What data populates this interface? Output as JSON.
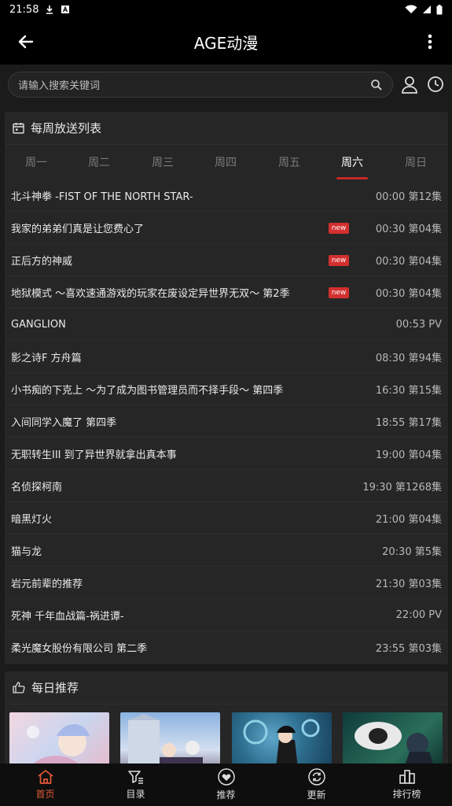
{
  "status_bar": {
    "time": "21:58"
  },
  "app_bar": {
    "title": "AGE动漫"
  },
  "search": {
    "placeholder": "请输入搜索关键词"
  },
  "weekly": {
    "title": "每周放送列表",
    "tabs": [
      {
        "label": "周一"
      },
      {
        "label": "周二"
      },
      {
        "label": "周三"
      },
      {
        "label": "周四"
      },
      {
        "label": "周五"
      },
      {
        "label": "周六",
        "active": true
      },
      {
        "label": "周日"
      }
    ],
    "new_label": "new",
    "items": [
      {
        "name": "北斗神拳 -FIST OF THE NORTH STAR-",
        "time": "00:00 第12集",
        "new": false
      },
      {
        "name": "我家的弟弟们真是让您费心了",
        "time": "00:30 第04集",
        "new": true
      },
      {
        "name": "正后方的神威",
        "time": "00:30 第04集",
        "new": true
      },
      {
        "name": "地狱模式 ～喜欢速通游戏的玩家在废设定异世界无双～ 第2季",
        "time": "00:30 第04集",
        "new": true
      },
      {
        "name": "GANGLION",
        "time": "00:53 PV",
        "new": false
      },
      {
        "name": "影之诗F 方舟篇",
        "time": "08:30 第94集",
        "new": false
      },
      {
        "name": "小书痴的下克上 ～为了成为图书管理员而不择手段～ 第四季",
        "time": "16:30 第15集",
        "new": false
      },
      {
        "name": "入间同学入魔了 第四季",
        "time": "18:55 第17集",
        "new": false
      },
      {
        "name": "无职转生III 到了异世界就拿出真本事",
        "time": "19:00 第04集",
        "new": false
      },
      {
        "name": "名侦探柯南",
        "time": "19:30 第1268集",
        "new": false
      },
      {
        "name": "暗黑灯火",
        "time": "21:00 第04集",
        "new": false
      },
      {
        "name": "猫与龙",
        "time": "20:30 第5集",
        "new": false
      },
      {
        "name": "岩元前辈的推荐",
        "time": "21:30 第03集",
        "new": false
      },
      {
        "name": "死神 千年血战篇-祸进谭-",
        "time": "22:00 PV",
        "new": false
      },
      {
        "name": "柔光魔女股份有限公司 第二季",
        "time": "23:55 第03集",
        "new": false
      }
    ]
  },
  "daily": {
    "title": "每日推荐"
  },
  "bottom_nav": [
    {
      "label": "首页",
      "icon": "home-icon",
      "active": true
    },
    {
      "label": "目录",
      "icon": "catalog-filter-icon"
    },
    {
      "label": "推荐",
      "icon": "heart-icon"
    },
    {
      "label": "更新",
      "icon": "refresh-icon"
    },
    {
      "label": "排行榜",
      "icon": "ranking-icon"
    }
  ],
  "colors": {
    "accent": "#c62828",
    "nav_active": "#e25a3a",
    "background": "#1b1b1b",
    "card": "#262626"
  }
}
